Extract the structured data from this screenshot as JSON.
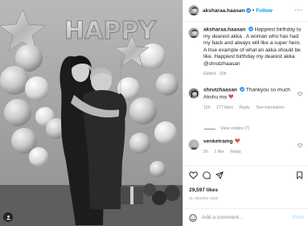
{
  "post": {
    "author": "aksharaa.haasan",
    "follow_label": "Follow",
    "caption": "Happiest birthday to my dearest akka . A woman who has had my back and always will like a super hero. A true example of what an akka should be like. Happiest birthday my dearest akka @shrutzhaasan",
    "caption_meta": "Edited · 10h",
    "likes": "29,597 likes",
    "age": "11 HOURS AGO",
    "balloon_text": "HAPPY"
  },
  "comments": [
    {
      "user": "shrutzhaasan",
      "text": "Thankyou so much Akshu ma",
      "time": "11h",
      "likes": "177 likes",
      "reply": "Reply",
      "translate": "See translation"
    },
    {
      "user": "venketramg",
      "text": "",
      "time": "5h",
      "likes": "1 like",
      "reply": "Reply"
    }
  ],
  "view_replies": "View replies (7)",
  "add_comment": {
    "placeholder": "Add a comment...",
    "post_label": "Post"
  },
  "colors": {
    "link": "#0095f6",
    "verified": "#3897f0",
    "like_red": "#ed4956",
    "muted": "#8e8e8e"
  },
  "icons": [
    "more-icon",
    "verified-icon",
    "heart-icon",
    "comment-icon",
    "share-icon",
    "bookmark-icon",
    "smiley-icon",
    "red-heart-emoji"
  ]
}
